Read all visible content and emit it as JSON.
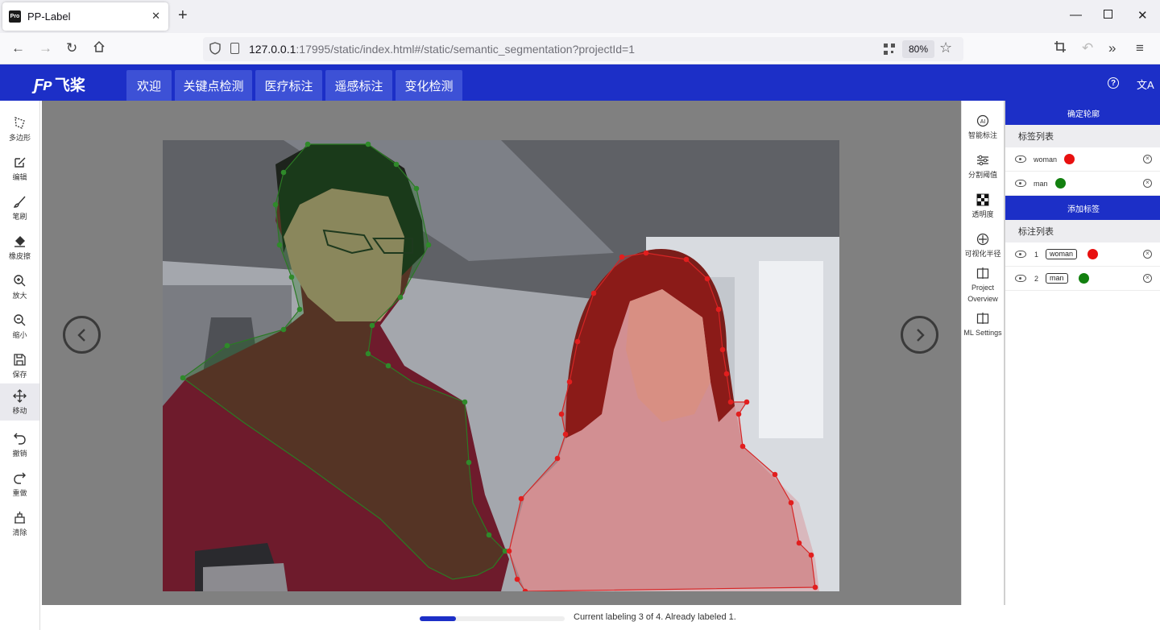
{
  "browser": {
    "tab_title": "PP-Label",
    "favicon_text": "Pro",
    "url_host": "127.0.0.1",
    "url_rest": ":17995/static/index.html#/static/semantic_segmentation?projectId=1",
    "zoom": "80%"
  },
  "header": {
    "logo_mark": "Ƒᴘ",
    "logo_text": "飞桨",
    "tabs": [
      {
        "label": "欢迎"
      },
      {
        "label": "关键点检测"
      },
      {
        "label": "医疗标注"
      },
      {
        "label": "遥感标注"
      },
      {
        "label": "变化检测"
      }
    ],
    "help_icon": "?",
    "translate_icon": "文A"
  },
  "left_tools": [
    {
      "label": "多边形",
      "icon": "polygon-icon"
    },
    {
      "label": "编辑",
      "icon": "edit-icon"
    },
    {
      "label": "笔刷",
      "icon": "brush-icon"
    },
    {
      "label": "橡皮擦",
      "icon": "eraser-icon"
    },
    {
      "label": "放大",
      "icon": "zoom-in-icon"
    },
    {
      "label": "缩小",
      "icon": "zoom-out-icon"
    },
    {
      "label": "保存",
      "icon": "save-icon"
    },
    {
      "label": "移动",
      "icon": "move-icon"
    },
    {
      "label": "撤销",
      "icon": "undo-icon"
    },
    {
      "label": "重做",
      "icon": "redo-icon"
    },
    {
      "label": "清除",
      "icon": "clear-icon"
    }
  ],
  "right_tools": [
    {
      "label": "智能标注",
      "icon": "ai-icon"
    },
    {
      "label": "分割阈值",
      "icon": "sliders-icon"
    },
    {
      "label": "透明度",
      "icon": "checker-icon"
    },
    {
      "label": "可视化半径",
      "icon": "crosshair-icon"
    },
    {
      "label": "Project Overview",
      "icon": "split-icon"
    },
    {
      "label": "ML Settings",
      "icon": "split-icon"
    }
  ],
  "panel": {
    "confirm_button": "确定轮廓",
    "label_list_title": "标签列表",
    "labels": [
      {
        "name": "woman",
        "color": "#e8100f"
      },
      {
        "name": "man",
        "color": "#12800f"
      }
    ],
    "add_label_button": "添加标签",
    "annotation_list_title": "标注列表",
    "annotations": [
      {
        "index": "1",
        "label": "woman",
        "color": "#e8100f"
      },
      {
        "index": "2",
        "label": "man",
        "color": "#12800f"
      }
    ]
  },
  "status": {
    "text": "Current labeling 3 of 4. Already labeled 1.",
    "progress": 0.25
  }
}
